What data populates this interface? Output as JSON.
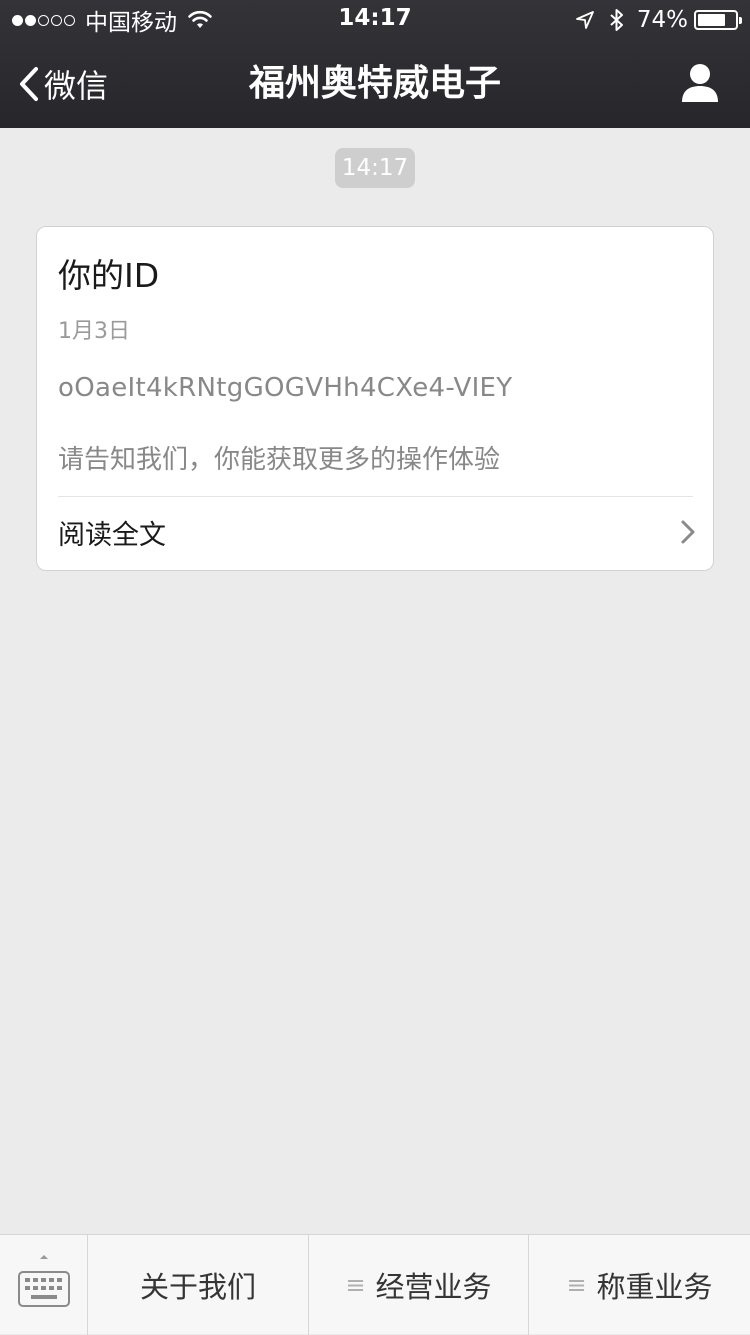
{
  "status_bar": {
    "carrier": "中国移动",
    "time": "14:17",
    "battery": "74%",
    "battery_level": 0.74,
    "signal_bars": 2,
    "icons": [
      "signal-dots-icon",
      "wifi-icon",
      "location-icon",
      "bluetooth-icon",
      "battery-icon"
    ]
  },
  "nav": {
    "back_label": "微信",
    "title": "福州奥特威电子",
    "icons": [
      "back-chevron-icon",
      "profile-icon"
    ]
  },
  "chat": {
    "timestamp": "14:17",
    "card": {
      "title": "你的ID",
      "date": "1月3日",
      "id_text": "oOaeIt4kRNtgGOGVHh4CXe4-VIEY",
      "description": "请告知我们，你能获取更多的操作体验",
      "read_more": "阅读全文"
    }
  },
  "bottom_menu": {
    "keyboard_icon": "keyboard-icon",
    "items": [
      {
        "label": "关于我们",
        "has_submenu": false
      },
      {
        "label": "经营业务",
        "has_submenu": true
      },
      {
        "label": "称重业务",
        "has_submenu": true
      }
    ]
  },
  "colors": {
    "nav_bg": "#2e2e33",
    "page_bg": "#ebebeb",
    "card_bg": "#ffffff",
    "timestamp_pill": "#cecece"
  }
}
